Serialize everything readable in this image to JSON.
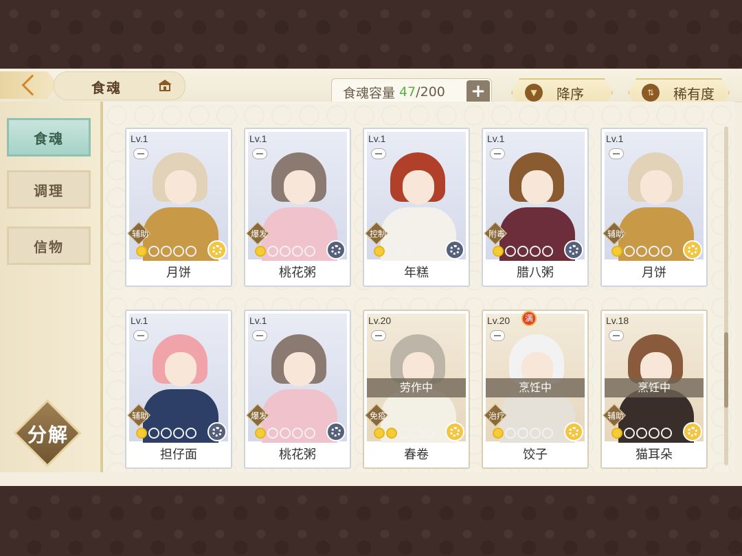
{
  "header": {
    "title": "食魂",
    "capacity_label": "食魂容量",
    "capacity_current": "47",
    "capacity_separator": "/",
    "capacity_max": "200",
    "capacity_plus": "+",
    "sort_desc_label": "降序",
    "sort_rarity_label": "稀有度"
  },
  "sidebar": {
    "tabs": [
      {
        "label": "食魂",
        "active": true
      },
      {
        "label": "调理",
        "active": false
      },
      {
        "label": "信物",
        "active": false
      }
    ],
    "decompose_label": "分解"
  },
  "cards": [
    {
      "level": "Lv.1",
      "name": "月饼",
      "role": "辅助",
      "stars": 1,
      "element": "gold",
      "hair": "#e2d3b8",
      "body": "#c89a48",
      "status": "",
      "full": ""
    },
    {
      "level": "Lv.1",
      "name": "桃花粥",
      "role": "爆发",
      "stars": 1,
      "element": "blue",
      "hair": "#8b7a72",
      "body": "#f0c2cc",
      "status": "",
      "full": ""
    },
    {
      "level": "Lv.1",
      "name": "年糕",
      "role": "控制",
      "stars": 1,
      "element": "blue",
      "hair": "#b0402a",
      "body": "#f4f0ea",
      "status": "",
      "full": ""
    },
    {
      "level": "Lv.1",
      "name": "腊八粥",
      "role": "附毒",
      "stars": 1,
      "element": "blue",
      "hair": "#8a5a30",
      "body": "#6b2e3a",
      "status": "",
      "full": ""
    },
    {
      "level": "Lv.1",
      "name": "月饼",
      "role": "辅助",
      "stars": 1,
      "element": "gold",
      "hair": "#e2d3b8",
      "body": "#c89a48",
      "status": "",
      "full": ""
    },
    {
      "level": "Lv.1",
      "name": "担仔面",
      "role": "辅助",
      "stars": 1,
      "element": "blue",
      "hair": "#f0a3a8",
      "body": "#2d3f66",
      "status": "",
      "full": ""
    },
    {
      "level": "Lv.1",
      "name": "桃花粥",
      "role": "爆发",
      "stars": 1,
      "element": "blue",
      "hair": "#8b7a72",
      "body": "#f0c2cc",
      "status": "",
      "full": ""
    },
    {
      "level": "Lv.20",
      "name": "春卷",
      "role": "免疫",
      "stars": 2,
      "element": "gold",
      "hair": "#bdb6a8",
      "body": "#f3f0e6",
      "status": "劳作中",
      "full": ""
    },
    {
      "level": "Lv.20",
      "name": "饺子",
      "role": "治疗",
      "stars": 1,
      "element": "gold",
      "hair": "#f2f2f2",
      "body": "#e6e1d8",
      "status": "烹饪中",
      "full": "满"
    },
    {
      "level": "Lv.18",
      "name": "猫耳朵",
      "role": "辅助",
      "stars": 1,
      "element": "gold",
      "hair": "#8a5a3c",
      "body": "#3a2e2a",
      "status": "烹饪中",
      "full": ""
    }
  ]
}
